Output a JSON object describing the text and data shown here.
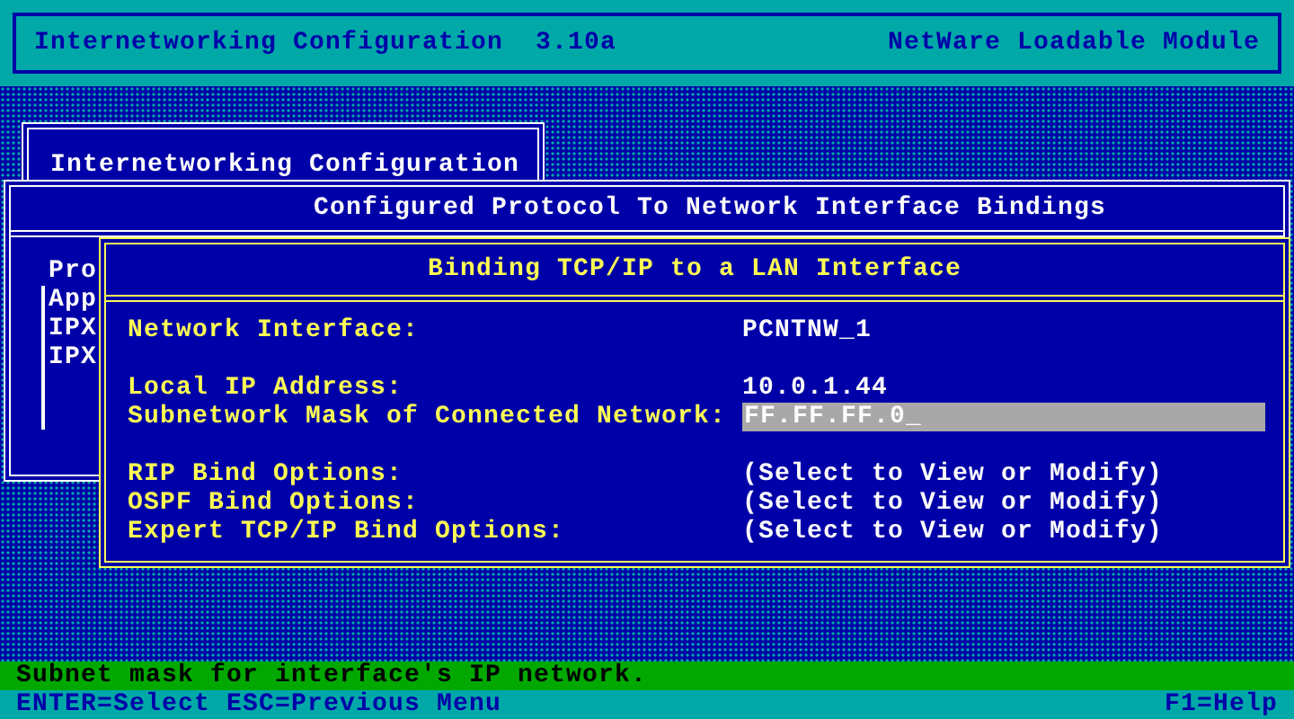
{
  "header": {
    "title": "Internetworking Configuration  3.10a",
    "module": "NetWare Loadable Module"
  },
  "main_menu": {
    "title": "Internetworking Configuration"
  },
  "bindings_window": {
    "title": "Configured Protocol To Network Interface Bindings",
    "column_1": "Pro",
    "rows": [
      {
        "label": "App"
      },
      {
        "label": "IPX"
      },
      {
        "label": "IPX"
      }
    ]
  },
  "binding_dialog": {
    "title": "Binding TCP/IP to a LAN Interface",
    "groups": [
      [
        {
          "label": "Network Interface:",
          "value": "PCNTNW_1",
          "kind": "text"
        }
      ],
      [
        {
          "label": "Local IP Address:",
          "value": "10.0.1.44",
          "kind": "text"
        },
        {
          "label": "Subnetwork Mask of Connected Network:",
          "value": "FF.FF.FF.0_",
          "kind": "input"
        }
      ],
      [
        {
          "label": "RIP Bind Options:",
          "value": "(Select to View or Modify)",
          "kind": "option"
        },
        {
          "label": "OSPF Bind Options:",
          "value": "(Select to View or Modify)",
          "kind": "option"
        },
        {
          "label": "Expert TCP/IP Bind Options:",
          "value": "(Select to View or Modify)",
          "kind": "option"
        }
      ]
    ]
  },
  "help_line": "Subnet mask for interface's IP network.",
  "key_bar": {
    "keys": "ENTER=Select ESC=Previous Menu",
    "help": "F1=Help"
  }
}
